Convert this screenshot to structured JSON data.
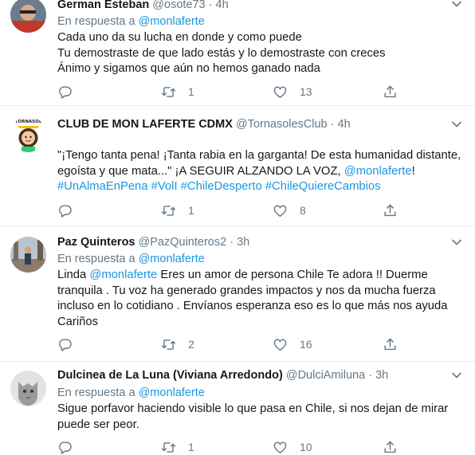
{
  "tweets": [
    {
      "name": "German Esteban",
      "handle": "@osote73",
      "separator": "·",
      "time": "4h",
      "reply_prefix": "En respuesta a",
      "reply_to": "@monlaferte",
      "lines": [
        "Cada uno da su lucha en donde y como puede",
        "Tu demostraste de que lado estás y lo demostraste con creces",
        "Ánimo y sigamos que aún no hemos ganado nada"
      ],
      "replies": "",
      "retweets": "1",
      "likes": "13"
    },
    {
      "name": "CLUB DE MON LAFERTE CDMX",
      "handle": "@TornasolesClub",
      "separator": "·",
      "time": "4h",
      "avatar_text": "TORNASOL",
      "line1": "\"¡Tengo tanta pena! ¡Tanta rabia en la garganta! De esta humanidad distante,",
      "line2_text": "egoísta y que mata...\" ¡A SEGUIR ALZANDO LA VOZ, ",
      "line2_mention": "@monlaferte",
      "line2_end": "!",
      "hashtags": [
        "#UnAlmaEnPena",
        "#VolI",
        "#ChileDesperto",
        "#ChileQuiereCambios"
      ],
      "replies": "",
      "retweets": "1",
      "likes": "8"
    },
    {
      "name": "Paz Quinteros",
      "handle": "@PazQuinteros2",
      "separator": "·",
      "time": "3h",
      "reply_prefix": "En respuesta a",
      "reply_to": "@monlaferte",
      "line1_text": "Linda ",
      "line1_mention": "@monlaferte",
      "line1_end": " Eres un amor de persona Chile Te adora !! Duerme",
      "lines": [
        "tranquila . Tu voz ha generado grandes impactos y nos da mucha fuerza",
        "incluso en lo cotidiano . Envíanos esperanza eso es lo que más nos ayuda",
        "Cariños"
      ],
      "replies": "",
      "retweets": "2",
      "likes": "16"
    },
    {
      "name": "Dulcinea de La Luna (Viviana Arredondo)",
      "handle": "@DulciAmiluna",
      "separator": "·",
      "time": "3h",
      "reply_prefix": "En respuesta a",
      "reply_to": "@monlaferte",
      "lines": [
        "Sigue porfavor haciendo visible lo que pasa en Chile,  si nos dejan de mirar",
        "puede ser peor."
      ],
      "replies": "",
      "retweets": "1",
      "likes": "10"
    }
  ],
  "colors": {
    "link": "#1b95e0",
    "secondary": "#657786",
    "text": "#14171a",
    "divider": "#e6ecf0"
  }
}
